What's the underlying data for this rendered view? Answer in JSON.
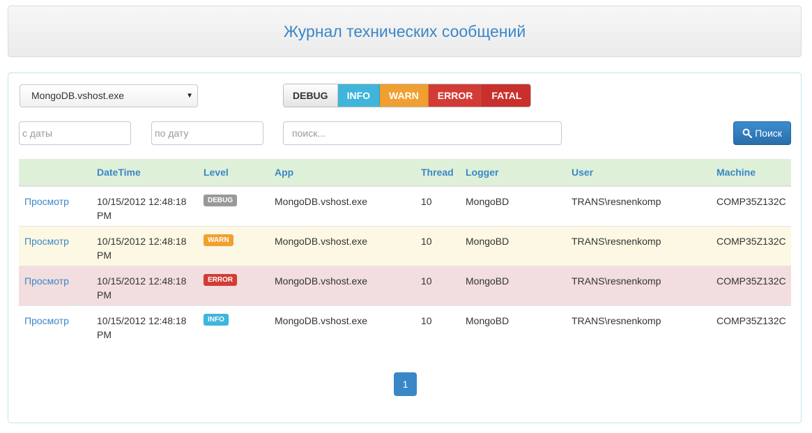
{
  "header": {
    "title": "Журнал технических сообщений"
  },
  "filters": {
    "app_select": "MongoDB.vshost.exe",
    "levels": [
      "DEBUG",
      "INFO",
      "WARN",
      "ERROR",
      "FATAL"
    ],
    "from_placeholder": "с даты",
    "to_placeholder": "по дату",
    "search_placeholder": "поиск...",
    "search_button": "Поиск"
  },
  "table": {
    "headers": [
      "DateTime",
      "Level",
      "App",
      "Thread",
      "Logger",
      "User",
      "Machine"
    ],
    "rows": [
      {
        "view": "Просмотр",
        "date": "10/15/2012 12:48:18 PM",
        "level": "DEBUG",
        "app": "MongoDB.vshost.exe",
        "thread": "10",
        "logger": "MongoBD",
        "user": "TRANS\\resnenkomp",
        "machine": "COMP35Z132C"
      },
      {
        "view": "Просмотр",
        "date": "10/15/2012 12:48:18 PM",
        "level": "WARN",
        "app": "MongoDB.vshost.exe",
        "thread": "10",
        "logger": "MongoBD",
        "user": "TRANS\\resnenkomp",
        "machine": "COMP35Z132C"
      },
      {
        "view": "Просмотр",
        "date": "10/15/2012 12:48:18 PM",
        "level": "ERROR",
        "app": "MongoDB.vshost.exe",
        "thread": "10",
        "logger": "MongoBD",
        "user": "TRANS\\resnenkomp",
        "machine": "COMP35Z132C"
      },
      {
        "view": "Просмотр",
        "date": "10/15/2012 12:48:18 PM",
        "level": "INFO",
        "app": "MongoDB.vshost.exe",
        "thread": "10",
        "logger": "MongoBD",
        "user": "TRANS\\resnenkomp",
        "machine": "COMP35Z132C"
      }
    ]
  },
  "pagination": {
    "current": "1"
  },
  "colors": {
    "accent": "#3a87c8",
    "header_row": "#dff0d8",
    "warn_row": "#fcf8e3",
    "error_row": "#f2dede"
  }
}
